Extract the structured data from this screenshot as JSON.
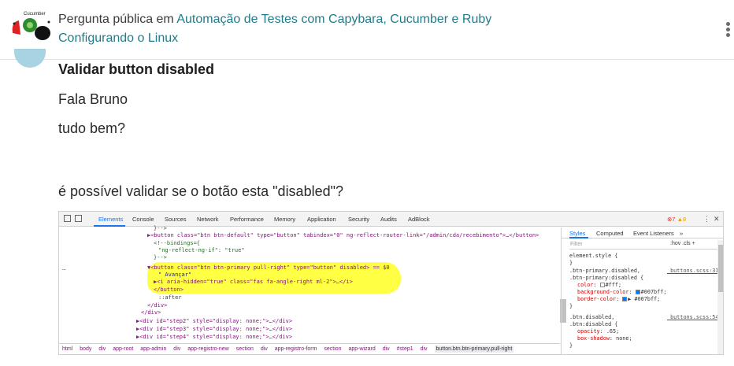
{
  "header": {
    "prefix": "Pergunta pública em ",
    "course_link": "Automação de Testes com Capybara, Cucumber e Ruby",
    "section_link": "Configurando o Linux",
    "logo_text": "Cucumber"
  },
  "post": {
    "title": "Validar button disabled",
    "paragraphs": [
      "Fala Bruno",
      "tudo bem?",
      "é possível validar se o botão esta \"disabled\"?"
    ]
  },
  "devtools": {
    "tabs": [
      "Elements",
      "Console",
      "Sources",
      "Network",
      "Performance",
      "Memory",
      "Application",
      "Security",
      "Audits",
      "AdBlock"
    ],
    "active_tab": "Elements",
    "status": {
      "errors": "7",
      "warnings": "8"
    },
    "code_lines": [
      "}-->",
      "▶<button class=\"btn btn-default\" type=\"button\" tabindex=\"0\" ng-reflect-router-link=\"/admin/cda/recebimento\">…</button>",
      "<!--bindings={",
      "  \"ng-reflect-ng-if\": \"true\"",
      "}-->",
      "▼<button class=\"btn btn-primary pull-right\" type=\"button\" disabled> == $0",
      "\" Avançar\"",
      "▶<i aria-hidden=\"true\" class=\"fas fa-angle-right ml-2\">…</i>",
      "</button>",
      "::after",
      "</div>",
      "</div>",
      "▶<div id=\"step2\" style=\"display: none;\">…</div>",
      "▶<div id=\"step3\" style=\"display: none;\">…</div>",
      "▶<div id=\"step4\" style=\"display: none;\">…</div>"
    ],
    "breadcrumbs": [
      "html",
      "body",
      "div",
      "app-root",
      "app-admin",
      "div",
      "app-registro-new",
      "section",
      "div",
      "app-registro-form",
      "section",
      "app-wizard",
      "div",
      "#step1",
      "div",
      "button.btn.btn-primary.pull-right"
    ],
    "styles": {
      "tabs": [
        "Styles",
        "Computed",
        "Event Listeners",
        "»"
      ],
      "filter_placeholder": "Filter",
      "filter_tools": ":hov  .cls  +",
      "element_style": "element.style {",
      "close1": "}",
      "rule1_selector_a": ".btn-primary.disabled,",
      "rule1_file": "_buttons.scss:31",
      "rule1_selector_b": ".btn-primary:disabled {",
      "rule1_props": [
        {
          "name": "color",
          "value": "#fff;",
          "swatch": "#ffffff"
        },
        {
          "name": "background-color",
          "value": "#007bff;",
          "swatch": "#007bff"
        },
        {
          "name": "border-color",
          "value": "▶ #007bff;",
          "swatch": "#007bff"
        }
      ],
      "close2": "}",
      "rule2_selector_a": ".btn.disabled,",
      "rule2_file": "_buttons.scss:54",
      "rule2_selector_b": ".btn:disabled {",
      "rule2_props": [
        {
          "name": "opacity",
          "value": ".65;"
        },
        {
          "name": "box-shadow",
          "value": "none;"
        }
      ],
      "close3": "}"
    }
  }
}
